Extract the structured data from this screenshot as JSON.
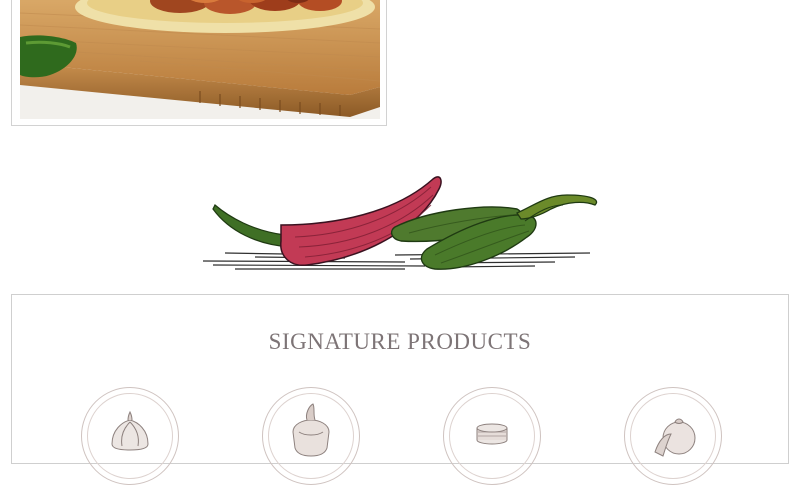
{
  "hero_photo": {
    "alt": "chicken taco on bamboo cutting board"
  },
  "divider_art": {
    "icon": "chili-peppers-illustration",
    "colors": {
      "red": "#c23a55",
      "green": "#4f7a2e"
    }
  },
  "signature_products": {
    "title": "SIGNATURE PRODUCTS",
    "items": [
      {
        "icon": "garlic-icon"
      },
      {
        "icon": "salsa-jar-icon"
      },
      {
        "icon": "tortilla-stack-icon"
      },
      {
        "icon": "tomato-icon"
      }
    ]
  }
}
